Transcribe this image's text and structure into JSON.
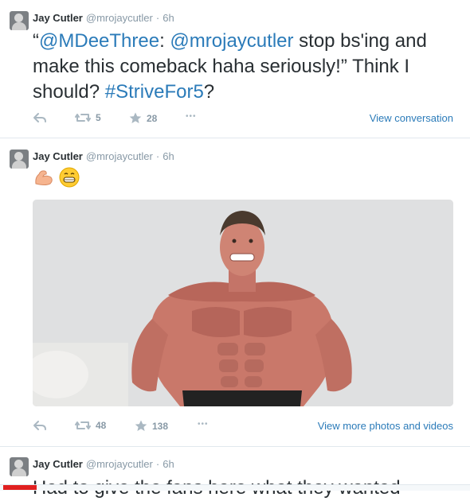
{
  "tweets": [
    {
      "name": "Jay Cutler",
      "handle": "@mrojaycutler",
      "dot": "·",
      "time": "6h",
      "text_parts": {
        "quote_open": "“",
        "mention1": "@MDeeThree",
        "colon": ": ",
        "mention2": "@mrojaycutler",
        "body": " stop bs'ing and make this comeback haha seriously!” Think I should? ",
        "hashtag": "#StriveFor5",
        "end": "?"
      },
      "retweets": "5",
      "favorites": "28",
      "more": "•••",
      "right_link": "View conversation"
    },
    {
      "name": "Jay Cutler",
      "handle": "@mrojaycutler",
      "dot": "·",
      "time": "6h",
      "emojis": [
        "flexed-biceps",
        "grinning-face"
      ],
      "media_description": "bodybuilder flexing photo",
      "retweets": "48",
      "favorites": "138",
      "more": "•••",
      "right_link": "View more photos and videos"
    },
    {
      "name": "Jay Cutler",
      "handle": "@mrojaycutler",
      "dot": "·",
      "time": "6h",
      "text_cut": "Had to give the fans here what they wanted"
    }
  ],
  "colors": {
    "link": "#2b7bb9",
    "muted": "#8899a6",
    "text": "#292f33",
    "divider": "#e1e8ed"
  }
}
